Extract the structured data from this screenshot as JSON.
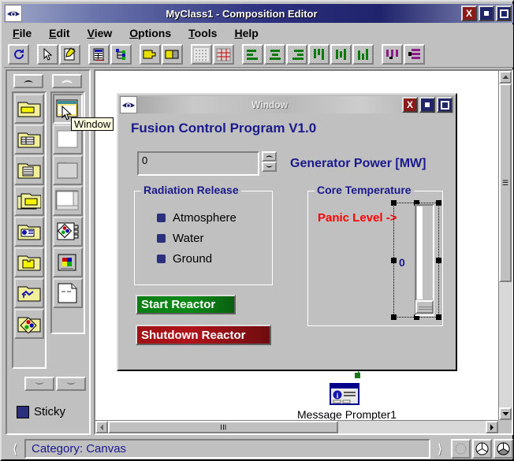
{
  "window": {
    "title": "MyClass1 - Composition Editor",
    "icon": "eye-icon",
    "controls": {
      "close": "X",
      "minimize": "minimize-icon",
      "maximize": "maximize-icon"
    }
  },
  "menubar": {
    "items": [
      {
        "label": "File",
        "accel": "F"
      },
      {
        "label": "Edit",
        "accel": "E"
      },
      {
        "label": "View",
        "accel": "V"
      },
      {
        "label": "Options",
        "accel": "O"
      },
      {
        "label": "Tools",
        "accel": "T"
      },
      {
        "label": "Help",
        "accel": "H"
      }
    ]
  },
  "toolbar": {
    "buttons": [
      {
        "name": "refresh-icon"
      },
      {
        "name": "pointer-icon"
      },
      {
        "name": "edit-properties-icon"
      },
      {
        "name": "table-view-icon"
      },
      {
        "name": "tree-view-icon"
      },
      {
        "name": "tab-forward-icon"
      },
      {
        "name": "tab-backward-icon"
      },
      {
        "name": "grid-dots-icon"
      },
      {
        "name": "grid-lines-icon"
      },
      {
        "name": "align-left-icon"
      },
      {
        "name": "align-center-icon"
      },
      {
        "name": "align-right-icon"
      },
      {
        "name": "align-top-icon"
      },
      {
        "name": "align-middle-icon"
      },
      {
        "name": "align-bottom-icon"
      },
      {
        "name": "distribute-horizontal-icon"
      },
      {
        "name": "distribute-vertical-icon"
      }
    ]
  },
  "palette": {
    "scroll_up_label": "scroll-up",
    "scroll_down_label": "scroll-down",
    "category_items": [
      {
        "name": "folder-window-icon"
      },
      {
        "name": "folder-table-icon"
      },
      {
        "name": "folder-list-icon"
      },
      {
        "name": "folder-group-icon"
      },
      {
        "name": "folder-info-icon"
      },
      {
        "name": "folder-puzzle-icon"
      },
      {
        "name": "folder-arrow-icon"
      },
      {
        "name": "folder-color-icon"
      }
    ],
    "widget_items": [
      {
        "name": "window-widget-icon",
        "selected": true
      },
      {
        "name": "panel-widget-icon",
        "selected": false
      },
      {
        "name": "notebook-widget-icon",
        "selected": false
      },
      {
        "name": "scrolled-window-widget-icon",
        "selected": false
      },
      {
        "name": "palette-widget-icon",
        "selected": false
      },
      {
        "name": "toolbar-widget-icon",
        "selected": false
      },
      {
        "name": "document-widget-icon",
        "selected": false
      }
    ],
    "sticky": {
      "label": "Sticky",
      "checked": true
    }
  },
  "tooltip": {
    "text": "Window"
  },
  "canvas": {
    "inner_window": {
      "title": "Window",
      "icon": "eye-icon",
      "controls": {
        "close": "X",
        "minimize": "minimize-icon",
        "maximize": "maximize-icon"
      },
      "heading": "Fusion Control Program V1.0",
      "spinner": {
        "value": "0",
        "up": "spin-up-icon",
        "down": "spin-down-icon"
      },
      "generator_label": "Generator Power [MW]",
      "radiation_group": {
        "title": "Radiation Release",
        "options": [
          {
            "label": "Atmosphere",
            "selected": true
          },
          {
            "label": "Water",
            "selected": true
          },
          {
            "label": "Ground",
            "selected": true
          }
        ]
      },
      "core_group": {
        "title": "Core Temperature",
        "panic_label": "Panic Level ->",
        "slider_value": "0"
      },
      "buttons": [
        {
          "label": "Start Reactor",
          "color": "#0c8a16"
        },
        {
          "label": "Shutdown Reactor",
          "color": "#b0141a"
        }
      ]
    },
    "message_prompter": {
      "label": "Message Prompter1",
      "icon": "message-prompter-icon"
    }
  },
  "statusbar": {
    "prev_icon": "prev-arrow-icon",
    "text": "Category: Canvas",
    "next_icon": "next-arrow-icon",
    "buttons": [
      {
        "name": "dither-pattern-button"
      },
      {
        "name": "pie-outline-button"
      },
      {
        "name": "pie-filled-button"
      }
    ]
  },
  "colors": {
    "titlebar_dark": "#20246b",
    "face": "#c0c0c0",
    "label_blue": "#1a1a8c",
    "panic_red": "#ff0000",
    "connector_blue": "#2b2f8c",
    "connector_green": "#1a7a1a"
  }
}
